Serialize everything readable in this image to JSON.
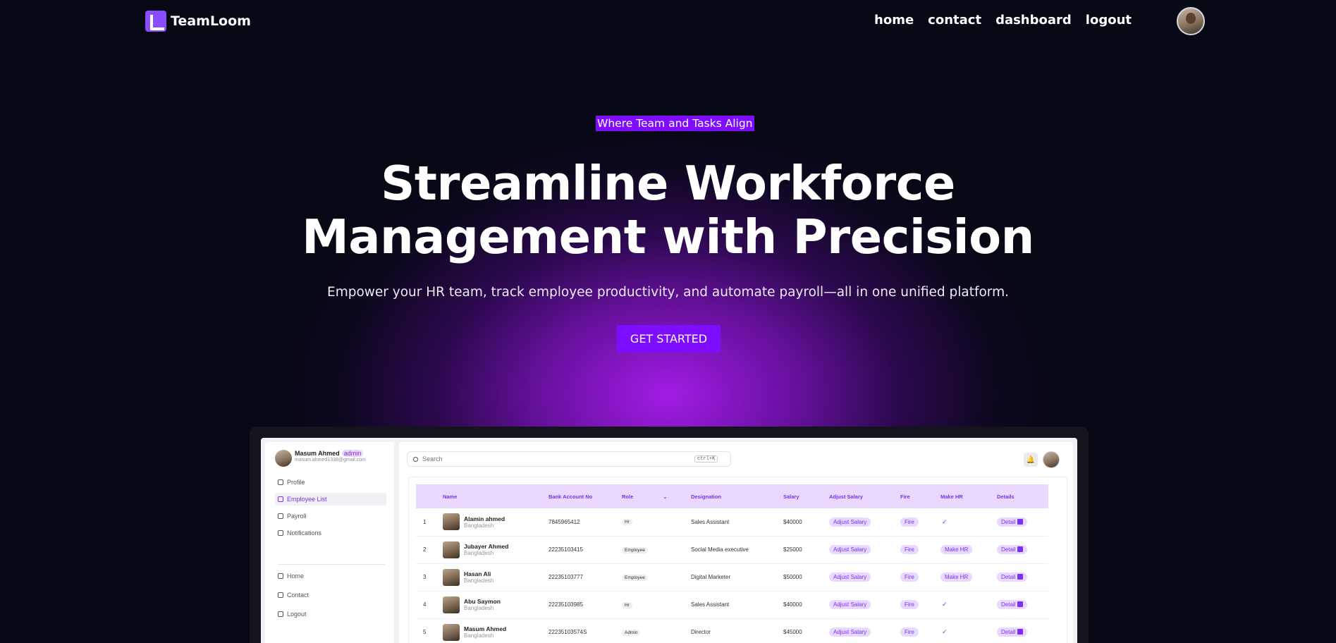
{
  "nav": {
    "brand": "TeamLoom",
    "links": [
      "home",
      "contact",
      "dashboard",
      "logout"
    ]
  },
  "hero": {
    "tagline": "Where Team and Tasks Align",
    "headline_line1": "Streamline Workforce",
    "headline_line2": "Management with Precision",
    "subline": "Empower your HR team, track employee productivity, and automate payroll—all in one unified platform.",
    "cta": "GET STARTED"
  },
  "mockup": {
    "user": {
      "name": "Masum Ahmed",
      "role": "admin",
      "email": "masum.ahmed1338@gmail.com"
    },
    "menu": [
      "Profile",
      "Employee List",
      "Payroll",
      "Notifications"
    ],
    "menu_bottom": [
      "Home",
      "Contact",
      "Logout"
    ],
    "search": {
      "placeholder": "Search",
      "shortcut": "ctrl+K"
    },
    "table": {
      "headers": [
        "",
        "Name",
        "Bank Account No",
        "Role",
        "Designation",
        "Salary",
        "Adjust Salary",
        "Fire",
        "Make HR",
        "Details"
      ],
      "rows": [
        {
          "idx": "1",
          "name": "Alamin ahmed",
          "country": "Bangladesh",
          "bank": "7845965412",
          "role": "Hr",
          "designation": "Sales Assistant",
          "salary": "$40000",
          "adjust": "Adjust Salary",
          "fire": "Fire",
          "make_hr": "✓",
          "details": "Detail"
        },
        {
          "idx": "2",
          "name": "Jubayer Ahmed",
          "country": "Bangladesh",
          "bank": "22235103415",
          "role": "Employee",
          "designation": "Social Media executive",
          "salary": "$25000",
          "adjust": "Adjust Salary",
          "fire": "Fire",
          "make_hr": "Make HR",
          "details": "Detail"
        },
        {
          "idx": "3",
          "name": "Hasan Ali",
          "country": "Bangladesh",
          "bank": "22235103777",
          "role": "Employee",
          "designation": "Digital Marketer",
          "salary": "$50000",
          "adjust": "Adjust Salary",
          "fire": "Fire",
          "make_hr": "Make HR",
          "details": "Detail"
        },
        {
          "idx": "4",
          "name": "Abu Saymon",
          "country": "Bangladesh",
          "bank": "22235103985",
          "role": "Hr",
          "designation": "Sales Assistant",
          "salary": "$40000",
          "adjust": "Adjust Salary",
          "fire": "Fire",
          "make_hr": "✓",
          "details": "Detail"
        },
        {
          "idx": "5",
          "name": "Masum Ahmed",
          "country": "Bangladesh",
          "bank": "22235103574S",
          "role": "Admin",
          "designation": "Director",
          "salary": "$45000",
          "adjust": "Adjust Salary",
          "fire": "Fire",
          "make_hr": "✓",
          "details": "Detail"
        }
      ]
    }
  },
  "colors": {
    "accent": "#7e0cff",
    "background": "#060814",
    "pill_bg": "#e9d8ff",
    "pill_text": "#7b2ff7"
  }
}
